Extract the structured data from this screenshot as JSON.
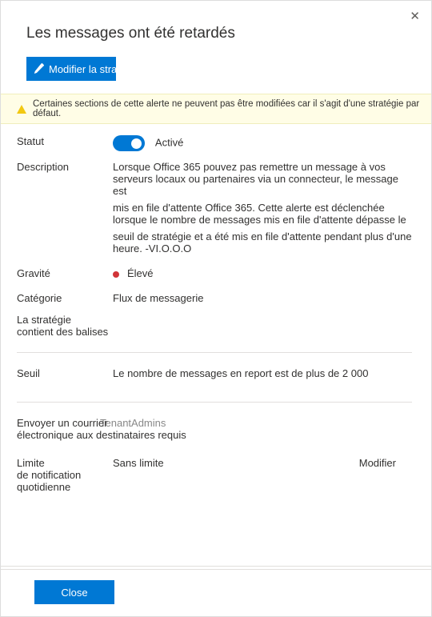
{
  "header": {
    "title": "Les messages ont été retardés",
    "edit_label": "Modifier la stratégie"
  },
  "warning": {
    "text": "Certaines sections de cette alerte ne peuvent pas être modifiées car il s'agit d'une stratégie par défaut."
  },
  "fields": {
    "status_label": "Statut",
    "status_value": "Activé",
    "description_label": "Description",
    "description_line1": "Lorsque Office 365 pouvez pas remettre un message à vos serveurs locaux ou partenaires via un connecteur, le message est",
    "description_line2": "mis en file d'attente Office 365. Cette alerte est déclenchée lorsque le nombre de messages mis en file d'attente dépasse le",
    "description_line3": "seuil de stratégie et a été mis en file d'attente pendant plus d'une heure. -VI.O.O.O",
    "severity_label": "Gravité",
    "severity_value": "Élevé",
    "category_label": "Catégorie",
    "category_value": "Flux de messagerie",
    "tags_label_line1": "La stratégie",
    "tags_label_line2": "contient des balises",
    "threshold_label": "Seuil",
    "threshold_value": "Le nombre de messages en report est de plus de 2 000",
    "recipients_label_line1": "Envoyer un courrier",
    "recipients_label_line2": "électronique aux destinataires requis",
    "recipients_value": "TenantAdmins",
    "limit_label_line1": "Limite",
    "limit_label_line2": "de notification",
    "limit_label_line3": "quotidienne",
    "limit_value": "Sans limite",
    "modify_label": "Modifier"
  },
  "footer": {
    "close_label": "Close"
  }
}
